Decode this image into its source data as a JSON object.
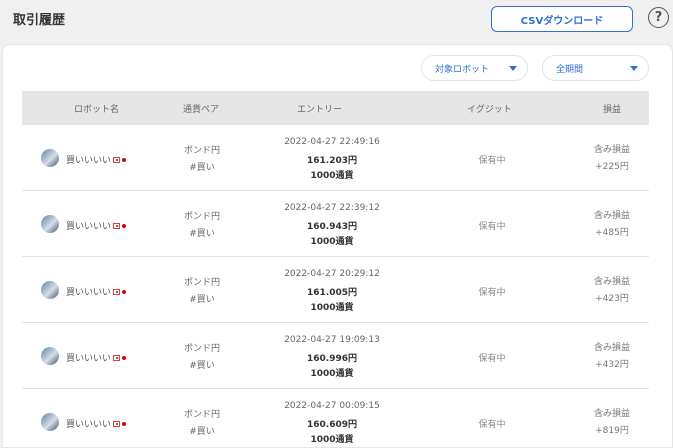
{
  "header": {
    "title": "取引履歴",
    "csv_button": "CSVダウンロード",
    "help": "?"
  },
  "filters": {
    "robot": "対象ロボット",
    "period": "全期間"
  },
  "table": {
    "columns": [
      "ロボット名",
      "通貨ペア",
      "エントリー",
      "イグジット",
      "損益"
    ],
    "rows": [
      {
        "robot": "買いいいい",
        "pair": "ポンド円",
        "side": "#買い",
        "datetime": "2022-04-27 22:49:16",
        "price": "161.203円",
        "qty": "1000通貨",
        "exit": "保有中",
        "pl_label": "含み損益",
        "pl": "+225円"
      },
      {
        "robot": "買いいいい",
        "pair": "ポンド円",
        "side": "#買い",
        "datetime": "2022-04-27 22:39:12",
        "price": "160.943円",
        "qty": "1000通貨",
        "exit": "保有中",
        "pl_label": "含み損益",
        "pl": "+485円"
      },
      {
        "robot": "買いいいい",
        "pair": "ポンド円",
        "side": "#買い",
        "datetime": "2022-04-27 20:29:12",
        "price": "161.005円",
        "qty": "1000通貨",
        "exit": "保有中",
        "pl_label": "含み損益",
        "pl": "+423円"
      },
      {
        "robot": "買いいいい",
        "pair": "ポンド円",
        "side": "#買い",
        "datetime": "2022-04-27 19:09:13",
        "price": "160.996円",
        "qty": "1000通貨",
        "exit": "保有中",
        "pl_label": "含み損益",
        "pl": "+432円"
      },
      {
        "robot": "買いいいい",
        "pair": "ポンド円",
        "side": "#買い",
        "datetime": "2022-04-27 00:09:15",
        "price": "160.609円",
        "qty": "1000通貨",
        "exit": "保有中",
        "pl_label": "含み損益",
        "pl": "+819円"
      }
    ]
  },
  "colors": {
    "accent": "#2f6fd6",
    "header_bg": "#e6e6e6",
    "page_bg": "#f0f0f0"
  },
  "icons": {
    "help": "question-circle-icon",
    "dropdown": "caret-down-icon",
    "flag": "uk-flag-icon",
    "status": "red-dot-icon"
  }
}
